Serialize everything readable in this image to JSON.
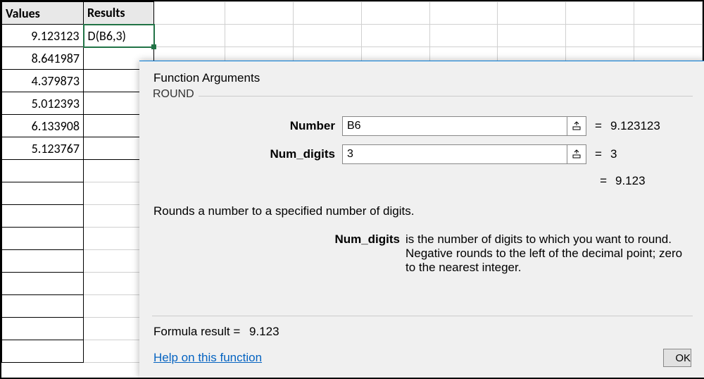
{
  "headers": {
    "a": "Values",
    "b": "Results"
  },
  "active_formula": "D(B6,3)",
  "values": [
    "9.123123",
    "8.641987",
    "4.379873",
    "5.012393",
    "6.133908",
    "5.123767"
  ],
  "dialog": {
    "title": "Function Arguments",
    "fn_name": "ROUND",
    "args": {
      "number": {
        "label": "Number",
        "value": "B6",
        "eval": "9.123123"
      },
      "num_digits": {
        "label": "Num_digits",
        "value": "3",
        "eval": "3"
      }
    },
    "result_eval": "9.123",
    "desc_main": "Rounds a number to a specified number of digits.",
    "desc_arg_name": "Num_digits",
    "desc_arg_text": "is the number of digits to which you want to round. Negative rounds to the left of the decimal point; zero to the nearest integer.",
    "formula_result_label": "Formula result =",
    "formula_result_value": "9.123",
    "help_link": "Help on this function",
    "ok_label": "OK",
    "eq": "="
  }
}
